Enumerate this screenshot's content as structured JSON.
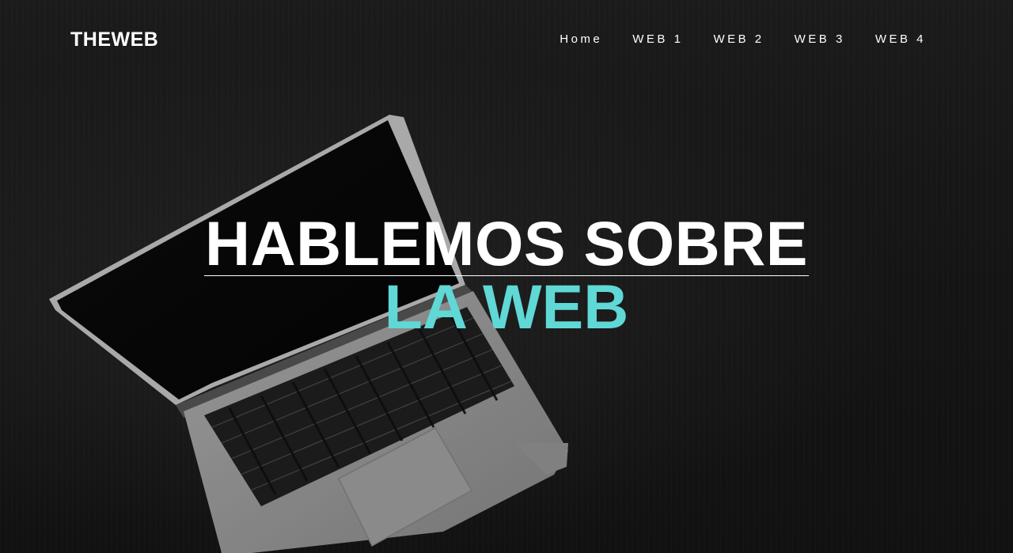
{
  "brand": {
    "logo_text": "THEWEB"
  },
  "nav": {
    "items": [
      {
        "label": "Home"
      },
      {
        "label": "WEB 1"
      },
      {
        "label": "WEB 2"
      },
      {
        "label": "WEB 3"
      },
      {
        "label": "WEB 4"
      }
    ]
  },
  "hero": {
    "title_line1": "HABLEMOS SOBRE",
    "title_line2": "LA WEB",
    "background_image": "laptop-on-dark-desk",
    "colors": {
      "title": "#ffffff",
      "accent": "#5fd8d6",
      "background": "#1b1b1b"
    }
  }
}
